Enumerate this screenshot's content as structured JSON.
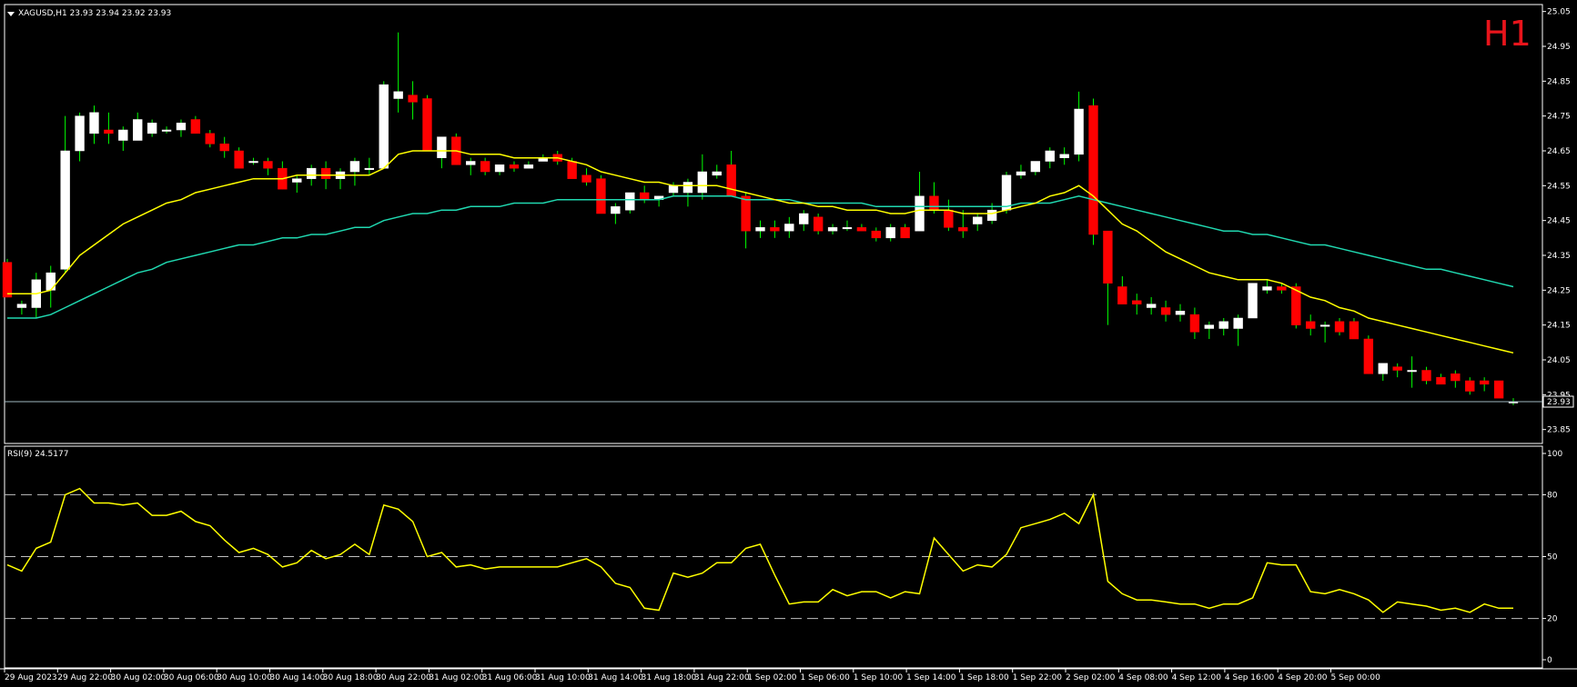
{
  "header": {
    "symbol_line": "XAGUSD,H1  23.93 23.94 23.92 23.93",
    "timeframe_badge": "H1",
    "timeframe_color": "#e8141b"
  },
  "rsi_panel": {
    "label": "RSI(9) 24.5177"
  },
  "current_price_label": "23.93",
  "colors": {
    "background": "#000000",
    "axes": "#ffffff",
    "bull_candle": "#ffffff",
    "bear_candle": "#ff0000",
    "wick": "#00ff00",
    "fast_ma": "#ffff00",
    "slow_ma": "#20d8b0",
    "rsi_line": "#ffff00",
    "rsi_levels": "#c0c0c0",
    "bid_line": "#a0b8c0"
  },
  "chart_data": [
    {
      "type": "candlestick",
      "title": "XAGUSD,H1",
      "ylim": [
        23.81,
        25.07
      ],
      "y_ticks": [
        "25.05",
        "24.95",
        "24.85",
        "24.75",
        "24.65",
        "24.55",
        "24.45",
        "24.35",
        "24.25",
        "24.15",
        "24.05",
        "23.95",
        "23.85"
      ],
      "current_price": 23.93,
      "x_ticks": [
        "29 Aug 2023",
        "29 Aug 22:00",
        "30 Aug 02:00",
        "30 Aug 06:00",
        "30 Aug 10:00",
        "30 Aug 14:00",
        "30 Aug 18:00",
        "30 Aug 22:00",
        "31 Aug 02:00",
        "31 Aug 06:00",
        "31 Aug 10:00",
        "31 Aug 14:00",
        "31 Aug 18:00",
        "31 Aug 22:00",
        "1 Sep 02:00",
        "1 Sep 06:00",
        "1 Sep 10:00",
        "1 Sep 14:00",
        "1 Sep 18:00",
        "1 Sep 22:00",
        "2 Sep 02:00",
        "4 Sep 08:00",
        "4 Sep 12:00",
        "4 Sep 16:00",
        "4 Sep 20:00",
        "5 Sep 00:00"
      ],
      "ohlc": [
        [
          24.33,
          24.34,
          24.23,
          24.23
        ],
        [
          24.2,
          24.22,
          24.18,
          24.21
        ],
        [
          24.2,
          24.3,
          24.17,
          24.28
        ],
        [
          24.25,
          24.32,
          24.2,
          24.3
        ],
        [
          24.31,
          24.75,
          24.3,
          24.65
        ],
        [
          24.65,
          24.76,
          24.62,
          24.75
        ],
        [
          24.7,
          24.78,
          24.67,
          24.76
        ],
        [
          24.71,
          24.76,
          24.67,
          24.7
        ],
        [
          24.68,
          24.72,
          24.65,
          24.71
        ],
        [
          24.68,
          24.76,
          24.68,
          24.74
        ],
        [
          24.7,
          24.74,
          24.69,
          24.73
        ],
        [
          24.71,
          24.72,
          24.7,
          24.71
        ],
        [
          24.71,
          24.74,
          24.69,
          24.73
        ],
        [
          24.74,
          24.75,
          24.7,
          24.7
        ],
        [
          24.7,
          24.71,
          24.66,
          24.67
        ],
        [
          24.67,
          24.69,
          24.63,
          24.65
        ],
        [
          24.65,
          24.66,
          24.6,
          24.6
        ],
        [
          24.62,
          24.63,
          24.61,
          24.62
        ],
        [
          24.62,
          24.63,
          24.58,
          24.6
        ],
        [
          24.6,
          24.62,
          24.54,
          24.54
        ],
        [
          24.56,
          24.58,
          24.53,
          24.57
        ],
        [
          24.57,
          24.61,
          24.55,
          24.6
        ],
        [
          24.6,
          24.62,
          24.54,
          24.57
        ],
        [
          24.57,
          24.6,
          24.54,
          24.59
        ],
        [
          24.59,
          24.63,
          24.55,
          24.62
        ],
        [
          24.6,
          24.63,
          24.58,
          24.6
        ],
        [
          24.6,
          24.85,
          24.6,
          24.84
        ],
        [
          24.8,
          24.99,
          24.76,
          24.82
        ],
        [
          24.81,
          24.85,
          24.74,
          24.79
        ],
        [
          24.8,
          24.81,
          24.65,
          24.65
        ],
        [
          24.63,
          24.68,
          24.6,
          24.69
        ],
        [
          24.69,
          24.7,
          24.61,
          24.61
        ],
        [
          24.61,
          24.63,
          24.58,
          24.62
        ],
        [
          24.62,
          24.63,
          24.58,
          24.59
        ],
        [
          24.59,
          24.61,
          24.58,
          24.61
        ],
        [
          24.61,
          24.62,
          24.59,
          24.6
        ],
        [
          24.6,
          24.62,
          24.6,
          24.61
        ],
        [
          24.62,
          24.64,
          24.62,
          24.63
        ],
        [
          24.64,
          24.65,
          24.61,
          24.62
        ],
        [
          24.62,
          24.63,
          24.57,
          24.57
        ],
        [
          24.58,
          24.6,
          24.55,
          24.56
        ],
        [
          24.57,
          24.58,
          24.47,
          24.47
        ],
        [
          24.47,
          24.5,
          24.44,
          24.49
        ],
        [
          24.48,
          24.51,
          24.47,
          24.53
        ],
        [
          24.53,
          24.55,
          24.5,
          24.51
        ],
        [
          24.51,
          24.52,
          24.49,
          24.52
        ],
        [
          24.53,
          24.56,
          24.52,
          24.55
        ],
        [
          24.53,
          24.57,
          24.49,
          24.56
        ],
        [
          24.53,
          24.64,
          24.51,
          24.59
        ],
        [
          24.58,
          24.61,
          24.57,
          24.59
        ],
        [
          24.61,
          24.65,
          24.52,
          24.52
        ],
        [
          24.52,
          24.53,
          24.37,
          24.42
        ],
        [
          24.42,
          24.45,
          24.4,
          24.43
        ],
        [
          24.43,
          24.45,
          24.4,
          24.42
        ],
        [
          24.42,
          24.46,
          24.4,
          24.44
        ],
        [
          24.44,
          24.48,
          24.42,
          24.47
        ],
        [
          24.46,
          24.47,
          24.41,
          24.42
        ],
        [
          24.42,
          24.44,
          24.41,
          24.43
        ],
        [
          24.43,
          24.45,
          24.42,
          24.43
        ],
        [
          24.43,
          24.44,
          24.42,
          24.42
        ],
        [
          24.42,
          24.43,
          24.39,
          24.4
        ],
        [
          24.4,
          24.44,
          24.39,
          24.43
        ],
        [
          24.43,
          24.44,
          24.4,
          24.4
        ],
        [
          24.42,
          24.59,
          24.42,
          24.52
        ],
        [
          24.52,
          24.56,
          24.47,
          24.48
        ],
        [
          24.48,
          24.51,
          24.42,
          24.43
        ],
        [
          24.43,
          24.48,
          24.4,
          24.42
        ],
        [
          24.44,
          24.47,
          24.42,
          24.46
        ],
        [
          24.45,
          24.5,
          24.44,
          24.48
        ],
        [
          24.48,
          24.59,
          24.47,
          24.58
        ],
        [
          24.58,
          24.61,
          24.57,
          24.59
        ],
        [
          24.59,
          24.62,
          24.58,
          24.62
        ],
        [
          24.62,
          24.66,
          24.6,
          24.65
        ],
        [
          24.63,
          24.66,
          24.61,
          24.64
        ],
        [
          24.64,
          24.82,
          24.62,
          24.77
        ],
        [
          24.78,
          24.8,
          24.38,
          24.41
        ],
        [
          24.42,
          24.42,
          24.15,
          24.27
        ],
        [
          24.26,
          24.29,
          24.21,
          24.21
        ],
        [
          24.22,
          24.24,
          24.18,
          24.21
        ],
        [
          24.2,
          24.23,
          24.18,
          24.21
        ],
        [
          24.2,
          24.22,
          24.16,
          24.18
        ],
        [
          24.18,
          24.21,
          24.16,
          24.19
        ],
        [
          24.18,
          24.2,
          24.11,
          24.13
        ],
        [
          24.14,
          24.16,
          24.11,
          24.15
        ],
        [
          24.14,
          24.17,
          24.12,
          24.16
        ],
        [
          24.14,
          24.18,
          24.09,
          24.17
        ],
        [
          24.17,
          24.27,
          24.17,
          24.27
        ],
        [
          24.25,
          24.28,
          24.24,
          24.26
        ],
        [
          24.26,
          24.27,
          24.24,
          24.25
        ],
        [
          24.26,
          24.27,
          24.14,
          24.15
        ],
        [
          24.16,
          24.18,
          24.12,
          24.14
        ],
        [
          24.15,
          24.16,
          24.1,
          24.15
        ],
        [
          24.16,
          24.17,
          24.12,
          24.13
        ],
        [
          24.16,
          24.17,
          24.12,
          24.11
        ],
        [
          24.11,
          24.12,
          24.01,
          24.01
        ],
        [
          24.01,
          24.04,
          23.99,
          24.04
        ],
        [
          24.03,
          24.04,
          24.0,
          24.02
        ],
        [
          24.02,
          24.06,
          23.97,
          24.02
        ],
        [
          24.02,
          24.03,
          23.98,
          23.99
        ],
        [
          24.0,
          24.01,
          23.98,
          23.98
        ],
        [
          24.01,
          24.02,
          23.97,
          23.99
        ],
        [
          23.99,
          24.0,
          23.95,
          23.96
        ],
        [
          23.99,
          24.0,
          23.96,
          23.98
        ],
        [
          23.99,
          23.99,
          23.94,
          23.94
        ],
        [
          23.93,
          23.94,
          23.92,
          23.93
        ]
      ],
      "ma_fast": [
        24.24,
        24.24,
        24.24,
        24.25,
        24.3,
        24.35,
        24.38,
        24.41,
        24.44,
        24.46,
        24.48,
        24.5,
        24.51,
        24.53,
        24.54,
        24.55,
        24.56,
        24.57,
        24.57,
        24.57,
        24.58,
        24.58,
        24.58,
        24.58,
        24.58,
        24.58,
        24.6,
        24.64,
        24.65,
        24.65,
        24.65,
        24.65,
        24.64,
        24.64,
        24.64,
        24.63,
        24.63,
        24.63,
        24.63,
        24.62,
        24.61,
        24.59,
        24.58,
        24.57,
        24.56,
        24.56,
        24.55,
        24.55,
        24.55,
        24.55,
        24.54,
        24.53,
        24.52,
        24.51,
        24.5,
        24.5,
        24.49,
        24.49,
        24.48,
        24.48,
        24.48,
        24.47,
        24.47,
        24.48,
        24.48,
        24.48,
        24.47,
        24.47,
        24.47,
        24.48,
        24.49,
        24.5,
        24.52,
        24.53,
        24.55,
        24.52,
        24.48,
        24.44,
        24.42,
        24.39,
        24.36,
        24.34,
        24.32,
        24.3,
        24.29,
        24.28,
        24.28,
        24.28,
        24.27,
        24.25,
        24.23,
        24.22,
        24.2,
        24.19,
        24.17,
        24.16,
        24.15,
        24.14,
        24.13,
        24.12,
        24.11,
        24.1,
        24.09,
        24.08,
        24.07
      ],
      "ma_slow": [
        24.17,
        24.17,
        24.17,
        24.18,
        24.2,
        24.22,
        24.24,
        24.26,
        24.28,
        24.3,
        24.31,
        24.33,
        24.34,
        24.35,
        24.36,
        24.37,
        24.38,
        24.38,
        24.39,
        24.4,
        24.4,
        24.41,
        24.41,
        24.42,
        24.43,
        24.43,
        24.45,
        24.46,
        24.47,
        24.47,
        24.48,
        24.48,
        24.49,
        24.49,
        24.49,
        24.5,
        24.5,
        24.5,
        24.51,
        24.51,
        24.51,
        24.51,
        24.51,
        24.51,
        24.51,
        24.51,
        24.52,
        24.52,
        24.52,
        24.52,
        24.52,
        24.51,
        24.51,
        24.51,
        24.51,
        24.5,
        24.5,
        24.5,
        24.5,
        24.5,
        24.49,
        24.49,
        24.49,
        24.49,
        24.49,
        24.49,
        24.49,
        24.49,
        24.49,
        24.49,
        24.5,
        24.5,
        24.5,
        24.51,
        24.52,
        24.51,
        24.5,
        24.49,
        24.48,
        24.47,
        24.46,
        24.45,
        24.44,
        24.43,
        24.42,
        24.42,
        24.41,
        24.41,
        24.4,
        24.39,
        24.38,
        24.38,
        24.37,
        24.36,
        24.35,
        24.34,
        24.33,
        24.32,
        24.31,
        24.31,
        24.3,
        24.29,
        24.28,
        24.27,
        24.26
      ]
    },
    {
      "type": "line",
      "title": "RSI(9) 24.5177",
      "ylim": [
        0,
        100
      ],
      "y_ticks": [
        0,
        20,
        50,
        80,
        100
      ],
      "levels": [
        80,
        50,
        20
      ],
      "series": [
        {
          "values": [
            46,
            43,
            54,
            57,
            80,
            83,
            76,
            76,
            75,
            76,
            70,
            70,
            72,
            67,
            65,
            58,
            52,
            54,
            51,
            45,
            47,
            53,
            49,
            51,
            56,
            51,
            75,
            73,
            67,
            50,
            52,
            45,
            46,
            44,
            45,
            45,
            45,
            45,
            45,
            47,
            49,
            45,
            37,
            35,
            25,
            24,
            42,
            40,
            42,
            47,
            47,
            54,
            56,
            41,
            27,
            28,
            28,
            34,
            31,
            33,
            33,
            30,
            33,
            32,
            59,
            51,
            43,
            46,
            45,
            51,
            64,
            66,
            68,
            71,
            66,
            80,
            38,
            32,
            29,
            29,
            28,
            27,
            27,
            25,
            27,
            27,
            30,
            47,
            46,
            46,
            33,
            32,
            34,
            32,
            29,
            23,
            28,
            27,
            26,
            24,
            25,
            23,
            27,
            25,
            25
          ]
        }
      ]
    }
  ]
}
